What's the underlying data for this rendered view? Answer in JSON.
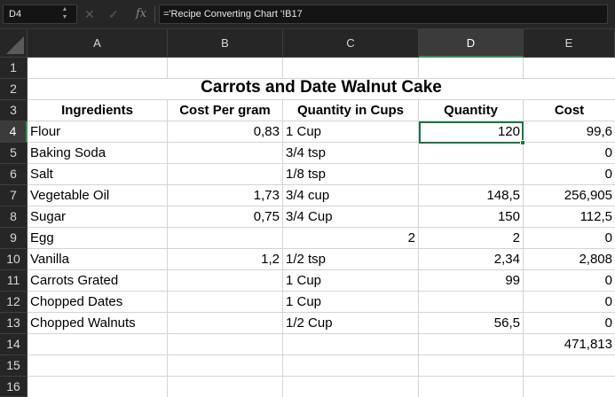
{
  "formula_bar": {
    "name_box": "D4",
    "formula": "='Recipe Converting Chart '!B17",
    "fx_label": "fx",
    "cancel_glyph": "✕",
    "enter_glyph": "✓"
  },
  "columns": [
    "A",
    "B",
    "C",
    "D",
    "E"
  ],
  "rows": [
    "1",
    "2",
    "3",
    "4",
    "5",
    "6",
    "7",
    "8",
    "9",
    "10",
    "11",
    "12",
    "13",
    "14",
    "15",
    "16"
  ],
  "sheet": {
    "title": "Carrots and Date Walnut Cake",
    "headers": [
      "Ingredients",
      "Cost Per gram",
      "Quantity in Cups",
      "Quantity",
      "Cost"
    ],
    "data": [
      [
        "Flour",
        "0,83",
        "1 Cup",
        "120",
        "99,6"
      ],
      [
        "Baking Soda",
        "",
        "3/4 tsp",
        "",
        "0"
      ],
      [
        "Salt",
        "",
        "1/8 tsp",
        "",
        "0"
      ],
      [
        "Vegetable Oil",
        "1,73",
        "3/4 cup",
        "148,5",
        "256,905"
      ],
      [
        "Sugar",
        "0,75",
        "3/4 Cup",
        "150",
        "112,5"
      ],
      [
        "Egg",
        "",
        "2",
        "2",
        "0"
      ],
      [
        "Vanilla",
        "1,2",
        "1/2 tsp",
        "2,34",
        "2,808"
      ],
      [
        "Carrots Grated",
        "",
        "1 Cup",
        "99",
        "0"
      ],
      [
        "Chopped Dates",
        "",
        "1 Cup",
        "",
        "0"
      ],
      [
        "Chopped Walnuts",
        "",
        "1/2 Cup",
        "56,5",
        "0"
      ]
    ],
    "total": "471,813"
  },
  "selection": {
    "cell": "D4",
    "column": "D",
    "row": "4"
  },
  "colors": {
    "accent": "#217346",
    "header_bg": "#262626",
    "grid": "#d4d4d4"
  }
}
